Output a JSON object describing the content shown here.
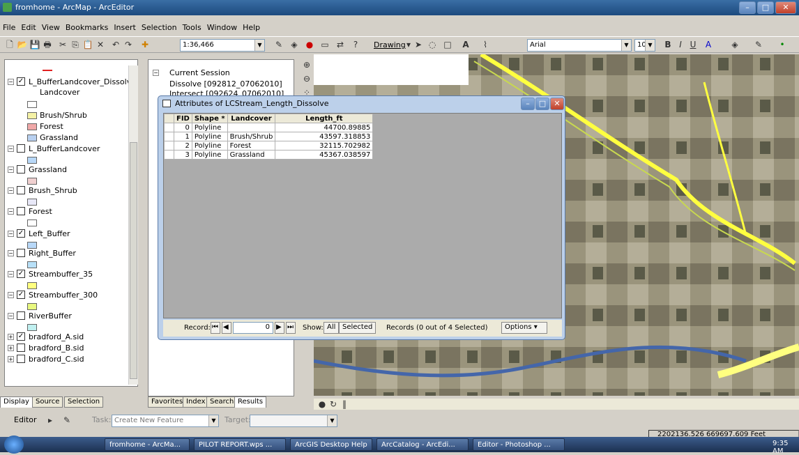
{
  "window": {
    "title": "fromhome - ArcMap - ArcEditor"
  },
  "menu": [
    "File",
    "Edit",
    "View",
    "Bookmarks",
    "Insert",
    "Selection",
    "Tools",
    "Window",
    "Help"
  ],
  "toolbar": {
    "scale": "1:36,466",
    "drawing_label": "Drawing",
    "font": "Arial",
    "font_size": "10"
  },
  "toc": {
    "layers": [
      {
        "name": "L_BufferLandcover_Dissolv",
        "checked": true
      },
      {
        "name": "Landcover",
        "type": "heading"
      },
      {
        "name": "",
        "type": "legend",
        "color": "#ffffff"
      },
      {
        "name": "Brush/Shrub",
        "type": "legend",
        "color": "#f5f2a6"
      },
      {
        "name": "Forest",
        "type": "legend",
        "color": "#f0a8a8"
      },
      {
        "name": "Grassland",
        "type": "legend",
        "color": "#b8d0f0"
      },
      {
        "name": "L_BufferLandcover",
        "checked": false
      },
      {
        "name": "",
        "type": "legend",
        "color": "#b8d8f8"
      },
      {
        "name": "Grassland",
        "checked": false
      },
      {
        "name": "",
        "type": "legend",
        "color": "#f0d0d0"
      },
      {
        "name": "Brush_Shrub",
        "checked": false
      },
      {
        "name": "",
        "type": "legend",
        "color": "#e8e8f8"
      },
      {
        "name": "Forest",
        "checked": false
      },
      {
        "name": "",
        "type": "legend",
        "color": "#ffffff"
      },
      {
        "name": "Left_Buffer",
        "checked": true
      },
      {
        "name": "",
        "type": "legend",
        "color": "#b8d8f8"
      },
      {
        "name": "Right_Buffer",
        "checked": false
      },
      {
        "name": "",
        "type": "legend",
        "color": "#b8e0f8"
      },
      {
        "name": "Streambuffer_35",
        "checked": true
      },
      {
        "name": "",
        "type": "legend",
        "color": "#ffff80"
      },
      {
        "name": "Streambuffer_300",
        "checked": true
      },
      {
        "name": "",
        "type": "legend",
        "color": "#e8f880"
      },
      {
        "name": "RiverBuffer",
        "checked": false
      },
      {
        "name": "",
        "type": "legend",
        "color": "#c0f0f0"
      },
      {
        "name": "bradford_A.sid",
        "checked": true
      },
      {
        "name": "bradford_B.sid",
        "checked": false
      },
      {
        "name": "bradford_C.sid",
        "checked": false
      }
    ],
    "tabs": [
      "Display",
      "Source",
      "Selection"
    ]
  },
  "results": {
    "root": "Current Session",
    "items": [
      "Dissolve [092812_07062010]",
      "Intersect [092624_07062010]"
    ],
    "tabs": [
      "Favorites",
      "Index",
      "Search",
      "Results"
    ]
  },
  "attribute_table": {
    "title": "Attributes of LCStream_Length_Dissolve",
    "columns": [
      "FID",
      "Shape *",
      "Landcover",
      "Length_ft"
    ],
    "rows": [
      [
        "0",
        "Polyline",
        "",
        "44700.89885"
      ],
      [
        "1",
        "Polyline",
        "Brush/Shrub",
        "43597.318853"
      ],
      [
        "2",
        "Polyline",
        "Forest",
        "32115.702982"
      ],
      [
        "3",
        "Polyline",
        "Grassland",
        "45367.038597"
      ]
    ],
    "record_label": "Record:",
    "record_value": "0",
    "show_label": "Show:",
    "show_all": "All",
    "show_selected": "Selected",
    "records_text": "Records (0 out of 4 Selected)",
    "options_label": "Options"
  },
  "editor": {
    "editor_label": "Editor",
    "task_label": "Task:",
    "task_value": "Create New Feature",
    "target_label": "Target:"
  },
  "status": {
    "coords": "2202136.526  669697.609 Feet"
  },
  "taskbar": {
    "tasks": [
      "fromhome - ArcMa...",
      "PILOT REPORT.wps ...",
      "ArcGIS Desktop Help",
      "ArcCatalog - ArcEdi...",
      "Editor - Photoshop ..."
    ],
    "clock": "9:35 AM"
  }
}
